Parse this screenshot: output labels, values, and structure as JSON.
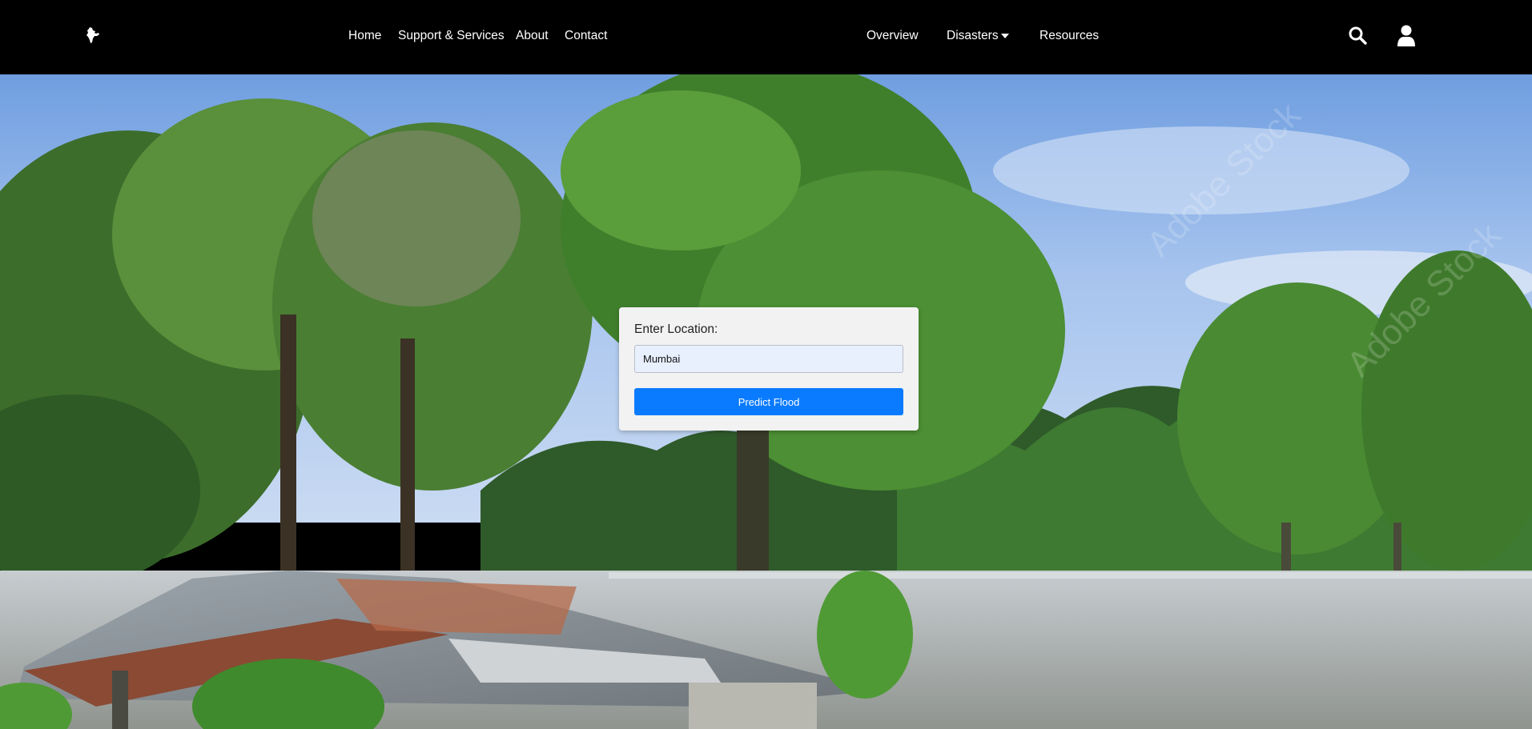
{
  "nav": {
    "logo_icon": "india-map-icon",
    "left_links": [
      "Home",
      "Support & Services",
      "About",
      "Contact"
    ],
    "right_links": [
      "Overview",
      "Disasters",
      "Resources"
    ],
    "disasters_has_dropdown": true,
    "search_icon": "search-icon",
    "user_icon": "user-icon"
  },
  "hero": {
    "scene": "flood-photo",
    "watermark": "Adobe Stock"
  },
  "form": {
    "label": "Enter Location:",
    "location_value": "Mumbai",
    "submit_label": "Predict Flood"
  },
  "colors": {
    "navbar_bg": "#000000",
    "button_bg": "#0a7bff",
    "card_bg": "#f2f2f2",
    "input_bg": "#e8f0fe"
  }
}
